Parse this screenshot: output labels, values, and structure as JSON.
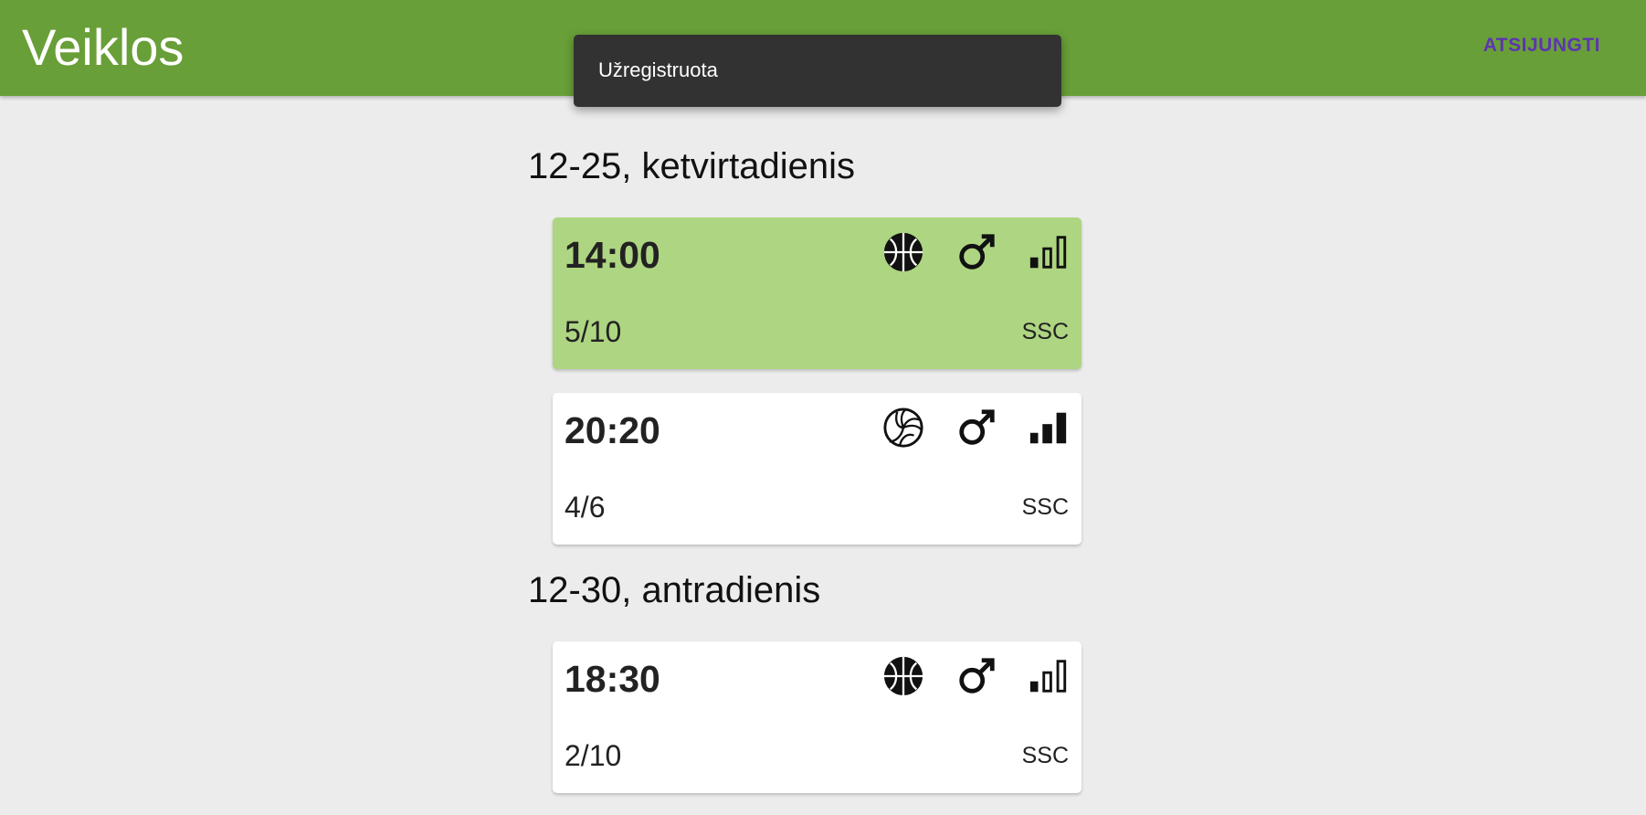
{
  "app": {
    "title": "Veiklos",
    "logout_label": "ATSIJUNGTI"
  },
  "snackbar": {
    "message": "Užregistruota"
  },
  "days": [
    {
      "heading": "12-25, ketvirtadienis",
      "activities": [
        {
          "time": "14:00",
          "count": "5/10",
          "place": "SSC",
          "sport_icon": "basketball-icon",
          "gender_icon": "male-icon",
          "level_icon": "signal-level-low-icon",
          "level": 1,
          "selected": true
        },
        {
          "time": "20:20",
          "count": "4/6",
          "place": "SSC",
          "sport_icon": "volleyball-icon",
          "gender_icon": "male-icon",
          "level_icon": "signal-level-full-icon",
          "level": 3,
          "selected": false
        }
      ]
    },
    {
      "heading": "12-30, antradienis",
      "activities": [
        {
          "time": "18:30",
          "count": "2/10",
          "place": "SSC",
          "sport_icon": "basketball-icon",
          "gender_icon": "male-icon",
          "level_icon": "signal-level-low-icon",
          "level": 1,
          "selected": false
        }
      ]
    }
  ],
  "colors": {
    "appbar": "#689f38",
    "selected_card": "#aed581",
    "logout": "#5e35b1",
    "background": "#ececec"
  }
}
